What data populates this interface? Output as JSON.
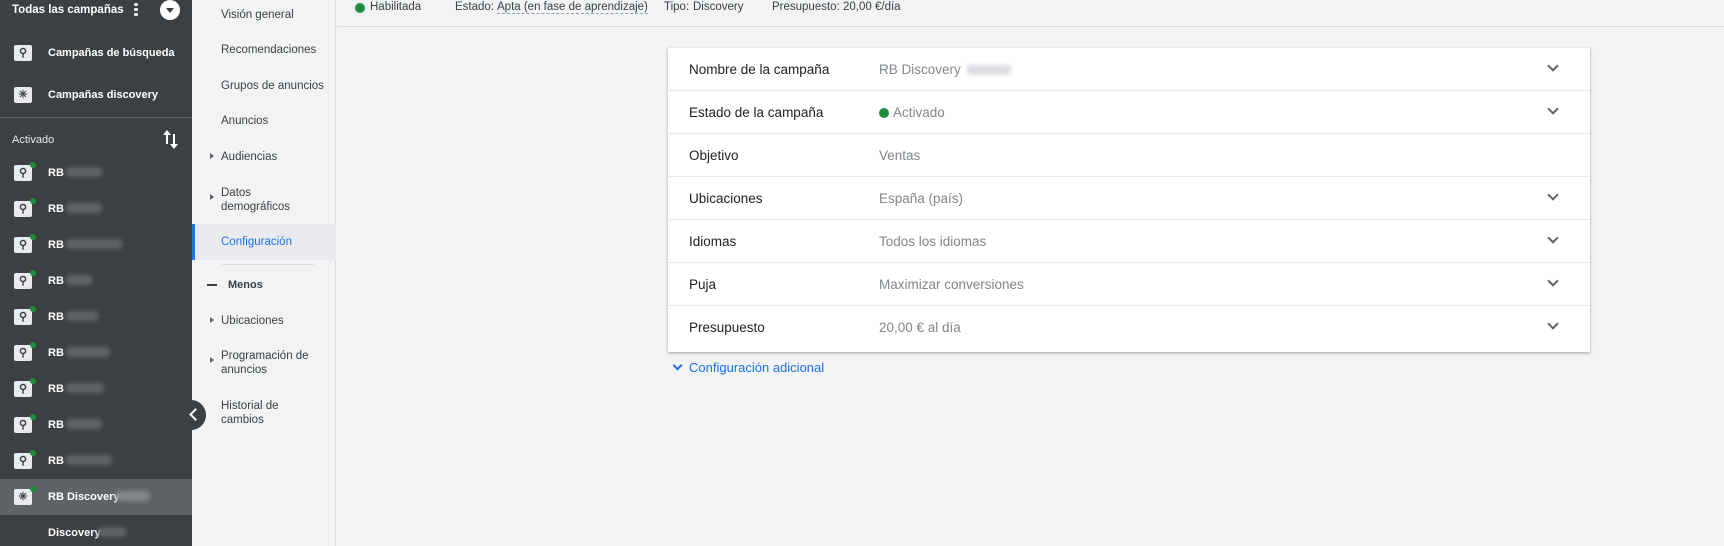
{
  "leftnav": {
    "title": "Todas las campañas",
    "search_campaigns": "Campañas de búsqueda",
    "discovery_campaigns": "Campañas discovery",
    "section": "Activado",
    "campaigns": [
      {
        "label": "RB",
        "selected": false
      },
      {
        "label": "RB",
        "selected": false
      },
      {
        "label": "RB",
        "selected": false
      },
      {
        "label": "RB",
        "selected": false
      },
      {
        "label": "RB",
        "selected": false
      },
      {
        "label": "RB",
        "selected": false
      },
      {
        "label": "RB",
        "selected": false
      },
      {
        "label": "RB",
        "selected": false
      },
      {
        "label": "RB",
        "selected": false
      },
      {
        "label": "RB Discovery",
        "selected": true
      }
    ],
    "adgroup": "Discovery"
  },
  "subnav": {
    "items": [
      "Visión general",
      "Recomendaciones",
      "Grupos de anuncios",
      "Anuncios",
      "Audiencias",
      "Datos demográficos",
      "Configuración"
    ],
    "less": "Menos",
    "more_items": [
      "Ubicaciones",
      "Programación de anuncios",
      "Historial de cambios"
    ]
  },
  "status_bar": {
    "state": "Habilitada",
    "estado_label": "Estado:",
    "estado_value": "Apta (en fase de aprendizaje)",
    "tipo_label": "Tipo:",
    "tipo_value": "Discovery",
    "presupuesto_label": "Presupuesto:",
    "presupuesto_value": "20,00 €/día"
  },
  "settings": {
    "rows": [
      {
        "key": "Nombre de la campaña",
        "value": "RB Discovery"
      },
      {
        "key": "Estado de la campaña",
        "value": "Activado"
      },
      {
        "key": "Objetivo",
        "value": "Ventas"
      },
      {
        "key": "Ubicaciones",
        "value": "España (país)"
      },
      {
        "key": "Idiomas",
        "value": "Todos los idiomas"
      },
      {
        "key": "Puja",
        "value": "Maximizar conversiones"
      },
      {
        "key": "Presupuesto",
        "value": "20,00 € al día"
      }
    ],
    "additional": "Configuración adicional"
  },
  "colors": {
    "accent": "#1a73e8",
    "status_green": "#1e8e3e",
    "nav_bg": "#3c4043"
  }
}
